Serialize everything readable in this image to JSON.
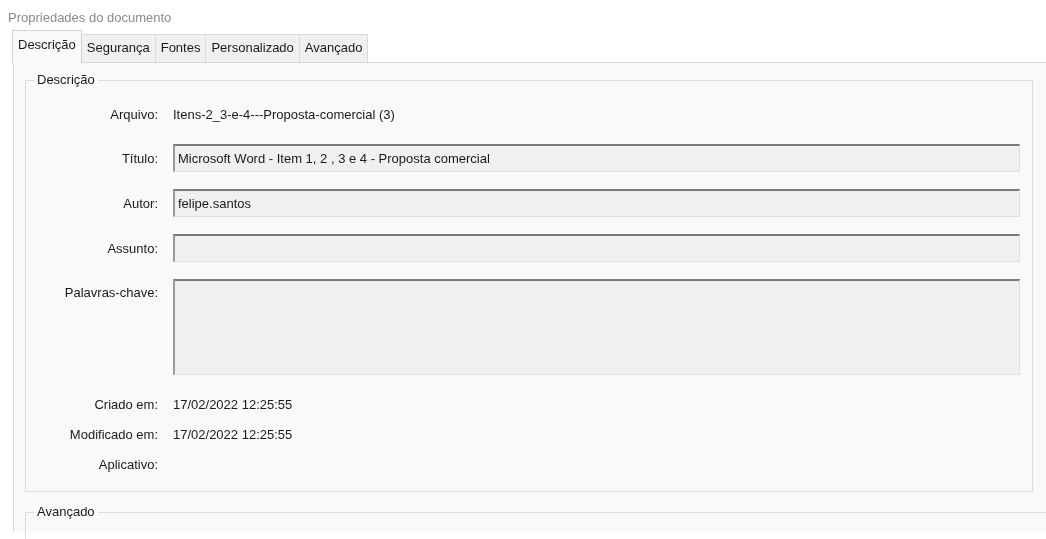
{
  "window": {
    "title": "Propriedades do documento"
  },
  "tabs": [
    {
      "label": "Descrição",
      "selected": true
    },
    {
      "label": "Segurança",
      "selected": false
    },
    {
      "label": "Fontes",
      "selected": false
    },
    {
      "label": "Personalizado",
      "selected": false
    },
    {
      "label": "Avançado",
      "selected": false
    }
  ],
  "description_group": {
    "title": "Descrição",
    "rows": [
      {
        "kind": "text",
        "label": "Arquivo:",
        "value": "Itens-2_3-e-4---Proposta-comercial (3)"
      },
      {
        "kind": "field",
        "label": "Título:",
        "value": "Microsoft Word - Item 1, 2 , 3 e 4 - Proposta comercial"
      },
      {
        "kind": "field",
        "label": "Autor:",
        "value": "felipe.santos"
      },
      {
        "kind": "field",
        "label": "Assunto:"
      },
      {
        "kind": "area",
        "label": "Palavras-chave:"
      },
      {
        "kind": "text",
        "label": "Criado em:",
        "value": "17/02/2022 12:25:55"
      },
      {
        "kind": "text",
        "label": "Modificado em:",
        "value": "17/02/2022 12:25:55"
      },
      {
        "kind": "text",
        "label": "Aplicativo:"
      }
    ]
  },
  "advanced_group": {
    "title": "Avançado"
  }
}
